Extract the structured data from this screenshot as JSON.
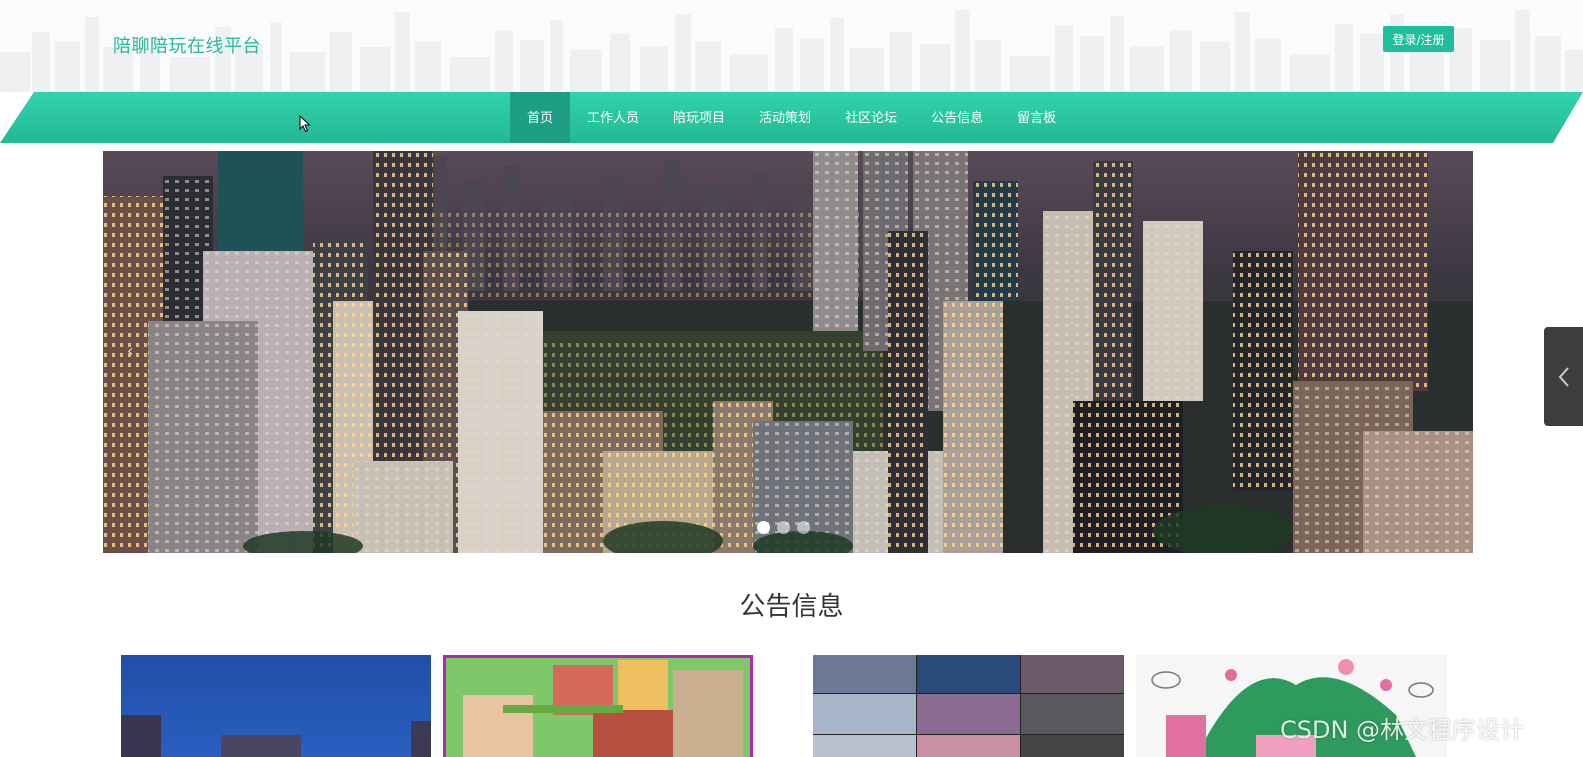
{
  "header": {
    "site_title": "陪聊陪玩在线平台",
    "login_label": "登录/注册"
  },
  "nav": {
    "items": [
      {
        "label": "首页",
        "active": true
      },
      {
        "label": "工作人员",
        "active": false
      },
      {
        "label": "陪玩项目",
        "active": false
      },
      {
        "label": "活动策划",
        "active": false
      },
      {
        "label": "社区论坛",
        "active": false
      },
      {
        "label": "公告信息",
        "active": false
      },
      {
        "label": "留言板",
        "active": false
      }
    ]
  },
  "banner": {
    "prev_glyph": "‹",
    "slide_count": 3,
    "active_slide": 1
  },
  "announcements": {
    "title": "公告信息"
  },
  "watermark": "CSDN @林文程序设计",
  "colors": {
    "accent": "#28b99a",
    "nav": "#2dc9a6",
    "nav_active": "#1e9e84"
  }
}
